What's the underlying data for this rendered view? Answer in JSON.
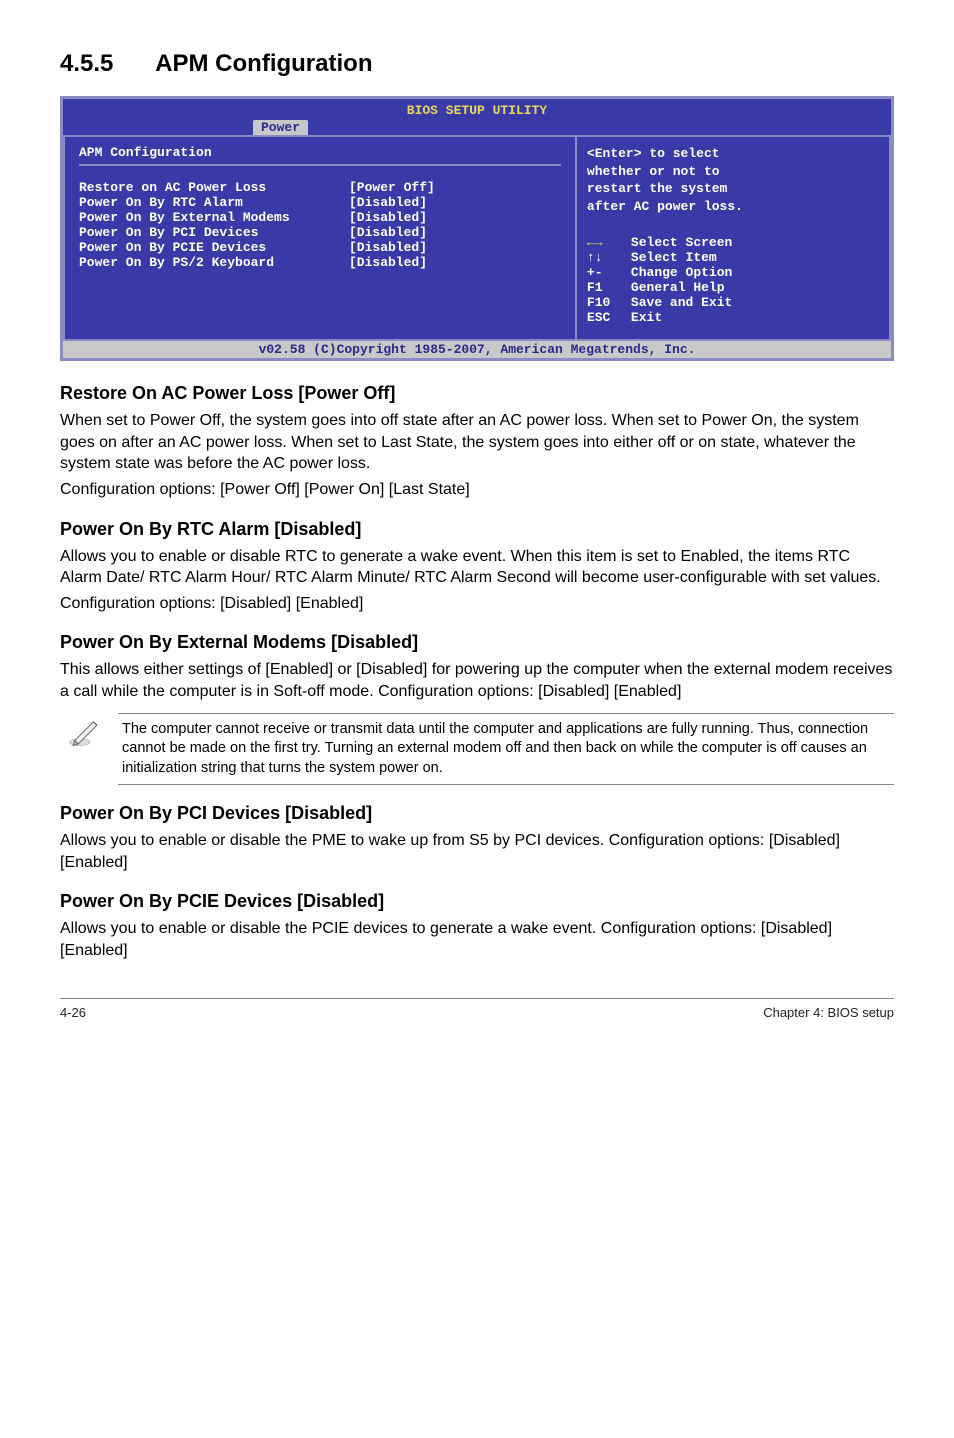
{
  "section": {
    "number": "4.5.5",
    "title": "APM Configuration"
  },
  "bios": {
    "title": "BIOS SETUP UTILITY",
    "tab": "Power",
    "panel_title": "APM Configuration",
    "rows": [
      {
        "label": "Restore on AC Power Loss",
        "value": "[Power Off]"
      },
      {
        "label": "Power On By RTC Alarm",
        "value": "[Disabled]"
      },
      {
        "label": "Power On By External Modems",
        "value": "[Disabled]"
      },
      {
        "label": "Power On By PCI Devices",
        "value": "[Disabled]"
      },
      {
        "label": "Power On By PCIE Devices",
        "value": "[Disabled]"
      },
      {
        "label": "Power On By PS/2 Keyboard",
        "value": "[Disabled]"
      }
    ],
    "help": {
      "l1": "<Enter> to select",
      "l2": "whether or not to",
      "l3": "restart the system",
      "l4": "after AC power loss."
    },
    "keys": [
      {
        "key": "←→",
        "desc": "Select Screen",
        "cls": "bios-key-arrows"
      },
      {
        "key": "↑↓",
        "desc": "Select Item"
      },
      {
        "key": "+-",
        "desc": "Change Option"
      },
      {
        "key": "F1",
        "desc": "General Help"
      },
      {
        "key": "F10",
        "desc": "Save and Exit"
      },
      {
        "key": "ESC",
        "desc": "Exit"
      }
    ],
    "footer": "v02.58 (C)Copyright 1985-2007, American Megatrends, Inc."
  },
  "h1": {
    "title": "Restore On AC Power Loss [Power Off]",
    "p1": "When set to Power Off, the system goes into off state after an AC power loss. When set to Power On, the system goes on after an AC power loss. When set to Last State, the system goes into either off or on state, whatever the system state was before the AC power loss.",
    "p2": "Configuration options: [Power Off] [Power On] [Last State]"
  },
  "h2": {
    "title": "Power On By RTC Alarm [Disabled]",
    "p1": "Allows you to enable or disable RTC to generate a wake event. When this item is set to Enabled, the items RTC Alarm Date/ RTC Alarm Hour/ RTC Alarm Minute/ RTC Alarm Second will become user-configurable with set values.",
    "p2": "Configuration options: [Disabled] [Enabled]"
  },
  "h3": {
    "title": "Power On By External Modems [Disabled]",
    "p1": "This allows either settings of [Enabled] or [Disabled] for powering up the computer when the external modem receives a call while the computer is in Soft-off mode. Configuration options: [Disabled] [Enabled]"
  },
  "note": "The computer cannot receive or transmit data until the computer and applications are fully running. Thus, connection cannot be made on the first try. Turning an external modem off and then back on while the computer is off causes an initialization string that turns the system power on.",
  "h4": {
    "title": "Power On By PCI Devices [Disabled]",
    "p1": "Allows you to enable or disable the PME to wake up from S5 by PCI devices. Configuration options: [Disabled] [Enabled]"
  },
  "h5": {
    "title": "Power On By PCIE Devices [Disabled]",
    "p1": "Allows you to enable or disable the PCIE devices to generate a wake event. Configuration options: [Disabled] [Enabled]"
  },
  "footer": {
    "left": "4-26",
    "right": "Chapter 4: BIOS setup"
  }
}
